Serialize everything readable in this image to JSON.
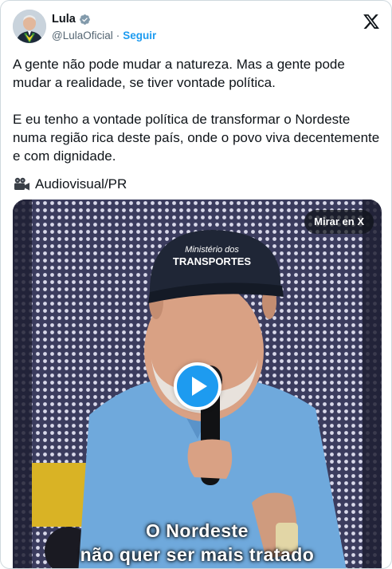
{
  "author": {
    "name": "Lula",
    "handle": "@LulaOficial",
    "separator": "·",
    "follow_label": "Seguir"
  },
  "tweet": {
    "paragraph1": "A gente não pode mudar a natureza. Mas a gente pode mudar a realidade, se tiver vontade política.",
    "paragraph2": "E eu tenho a vontade política de transformar o Nordeste numa região rica deste país, onde o povo viva decentemente e com dignidade.",
    "credit": "Audiovisual/PR"
  },
  "video": {
    "watch_label": "Mirar en X",
    "cap_line1": "Ministério dos",
    "cap_line2": "TRANSPORTES",
    "subtitle_line1": "O Nordeste",
    "subtitle_line2": "não quer ser mais tratado",
    "bg_cap_text": "Mi TRA"
  },
  "colors": {
    "link": "#1d9bf0",
    "text": "#0f1419",
    "muted": "#536471",
    "shirt": "#6fa9dc"
  },
  "icons": {
    "verified": "verified-badge-icon",
    "x_logo": "x-logo-icon",
    "camera": "movie-camera-icon",
    "play": "play-icon"
  }
}
